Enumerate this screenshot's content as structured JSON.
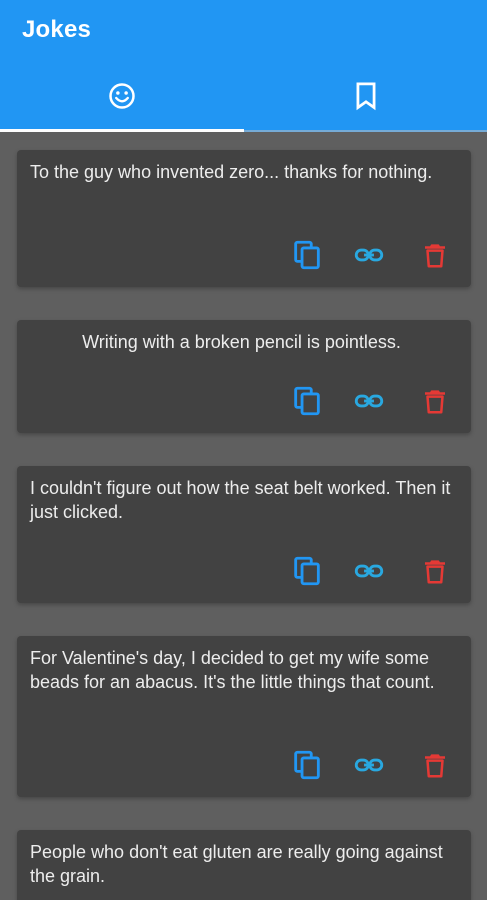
{
  "app": {
    "title": "Jokes",
    "colors": {
      "appbar": "#2196f3",
      "background": "#5f5f5f",
      "card": "#424242",
      "text": "#ededed",
      "copy_icon": "#2196f3",
      "link_icon": "#29a8e0",
      "delete_icon": "#e53935"
    }
  },
  "tabs": [
    {
      "icon": "smiley-face-icon",
      "selected": true
    },
    {
      "icon": "bookmark-icon",
      "selected": false
    }
  ],
  "jokes": [
    {
      "text": "To the guy who invented zero... thanks for nothing."
    },
    {
      "text": "Writing with a broken pencil is pointless."
    },
    {
      "text": "I couldn't figure out how the seat belt worked. Then it just clicked."
    },
    {
      "text": "For Valentine's day, I decided to get my wife some beads for an abacus.  It's the little things that count."
    },
    {
      "text": "People who don't eat gluten are really going against the grain."
    }
  ],
  "actions": {
    "icons": [
      "copy-icon",
      "link-icon",
      "delete-icon"
    ]
  }
}
